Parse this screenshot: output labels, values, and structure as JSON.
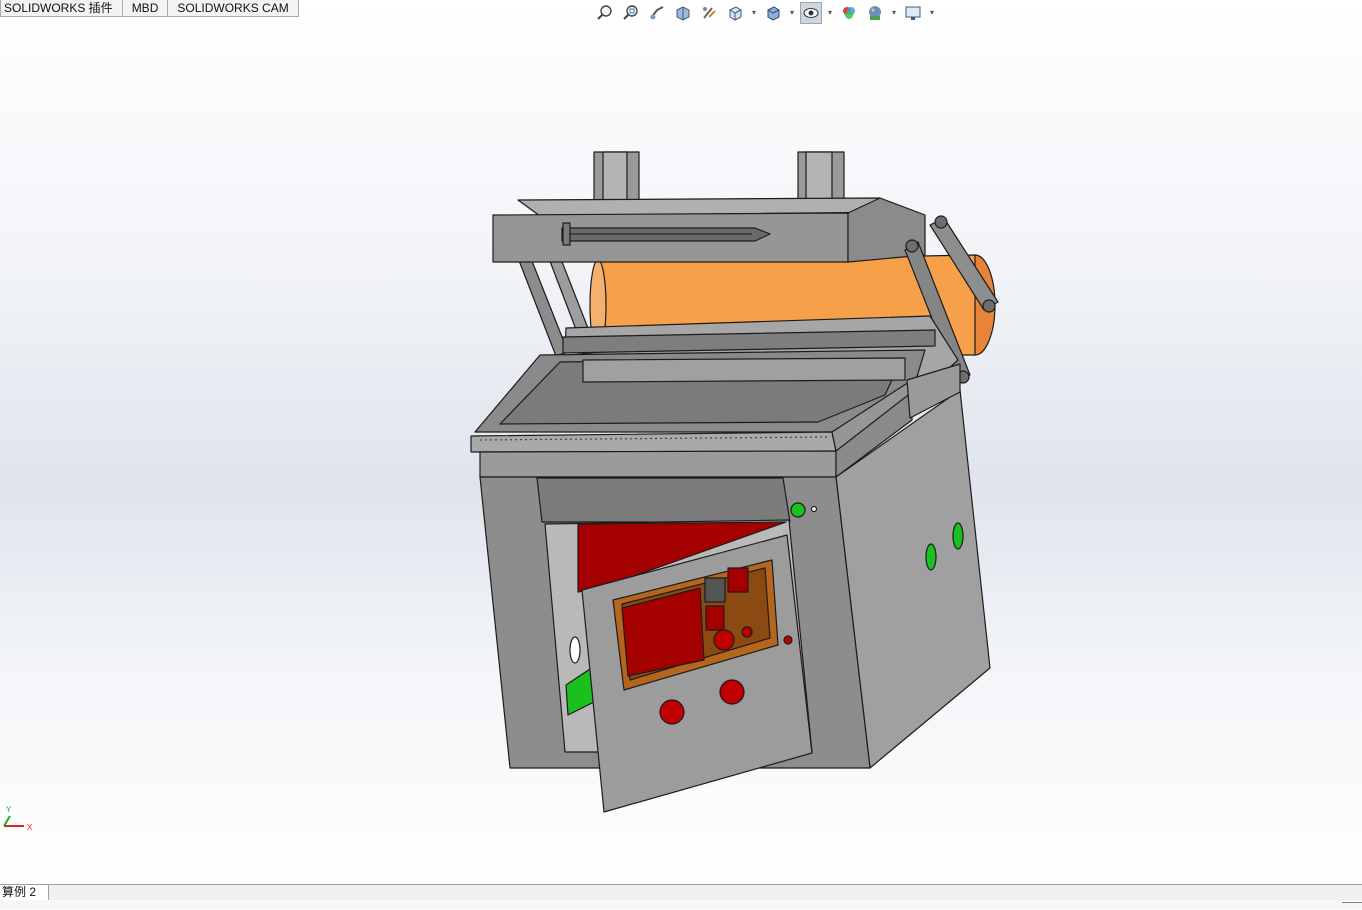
{
  "command_manager": {
    "tabs": [
      "SOLIDWORKS 插件",
      "MBD",
      "SOLIDWORKS CAM"
    ]
  },
  "heads_up_toolbar": {
    "icons": [
      "zoom-to-fit-icon",
      "zoom-to-area-icon",
      "previous-view-icon",
      "section-view-icon",
      "dynamic-annotation-views-icon",
      "view-orientation-icon",
      "display-style-icon",
      "hide-show-items-icon",
      "edit-appearance-icon",
      "apply-scene-icon",
      "view-settings-icon"
    ],
    "selected": "hide-show-items-icon"
  },
  "triad": {
    "x_label": "X",
    "y_label": "Y"
  },
  "sheet_tabs": [
    "算例 2"
  ],
  "colors": {
    "body_gray": "#8a8a8a",
    "panel_red": "#a50000",
    "roller_orange": "#f7a04a",
    "bezel_brown": "#b5651d",
    "indicator_green": "#19c01e"
  }
}
